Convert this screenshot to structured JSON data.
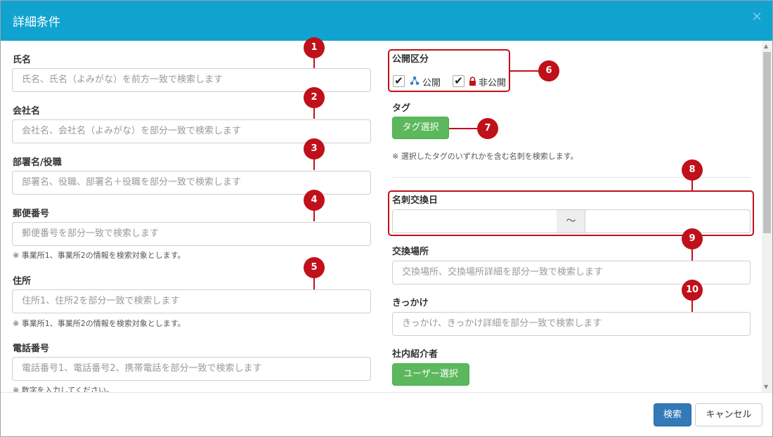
{
  "header": {
    "title": "詳細条件",
    "close": "×"
  },
  "left": {
    "name": {
      "label": "氏名",
      "placeholder": "氏名、氏名（よみがな）を前方一致で検索します"
    },
    "company": {
      "label": "会社名",
      "placeholder": "会社名、会社名（よみがな）を部分一致で検索します"
    },
    "department": {
      "label": "部署名/役職",
      "placeholder": "部署名、役職、部署名＋役職を部分一致で検索します"
    },
    "postal": {
      "label": "郵便番号",
      "placeholder": "郵便番号を部分一致で検索します",
      "note": "※ 事業所1、事業所2の情報を検索対象とします。"
    },
    "address": {
      "label": "住所",
      "placeholder": "住所1、住所2を部分一致で検索します",
      "note": "※ 事業所1、事業所2の情報を検索対象とします。"
    },
    "phone": {
      "label": "電話番号",
      "placeholder": "電話番号1、電話番号2、携帯電話を部分一致で検索します",
      "note": "※ 数字を入力してください。"
    }
  },
  "right": {
    "visibility": {
      "label": "公開区分",
      "public_label": "公開",
      "private_label": "非公開",
      "check": "✔"
    },
    "tag": {
      "label": "タグ",
      "button": "タグ選択",
      "note": "※ 選択したタグのいずれかを含む名刺を検索します。"
    },
    "exchange_date": {
      "label": "名刺交換日",
      "separator": "〜"
    },
    "exchange_place": {
      "label": "交換場所",
      "placeholder": "交換場所、交換場所詳細を部分一致で検索します"
    },
    "trigger": {
      "label": "きっかけ",
      "placeholder": "きっかけ、きっかけ詳細を部分一致で検索します"
    },
    "introducer": {
      "label": "社内紹介者",
      "button": "ユーザー選択"
    }
  },
  "markers": [
    "1",
    "2",
    "3",
    "4",
    "5",
    "6",
    "7",
    "8",
    "9",
    "10"
  ],
  "footer": {
    "search": "検索",
    "cancel": "キャンセル"
  },
  "colors": {
    "header": "#11a3cf",
    "marker": "#c0101a",
    "green": "#5cb85c",
    "primary": "#337ab7"
  }
}
